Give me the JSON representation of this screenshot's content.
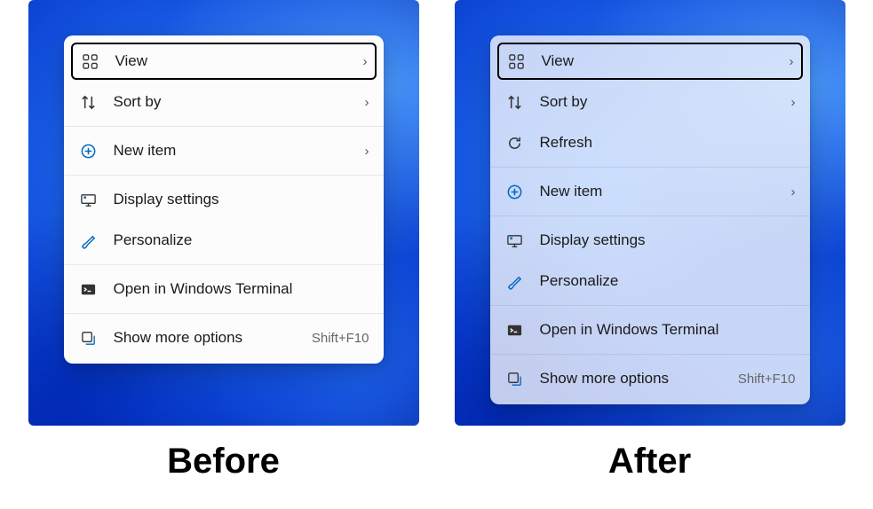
{
  "before": {
    "caption": "Before",
    "menu": [
      {
        "name": "view",
        "label": "View",
        "icon": "view",
        "chevron": true,
        "highlighted": true
      },
      {
        "name": "sort-by",
        "label": "Sort by",
        "icon": "sort",
        "chevron": true
      },
      {
        "sep": true
      },
      {
        "name": "new-item",
        "label": "New item",
        "icon": "new",
        "chevron": true
      },
      {
        "sep": true
      },
      {
        "name": "display-settings",
        "label": "Display settings",
        "icon": "display"
      },
      {
        "name": "personalize",
        "label": "Personalize",
        "icon": "brush"
      },
      {
        "sep": true
      },
      {
        "name": "open-terminal",
        "label": "Open in Windows Terminal",
        "icon": "terminal"
      },
      {
        "sep": true
      },
      {
        "name": "show-more",
        "label": "Show more options",
        "icon": "more",
        "shortcut": "Shift+F10"
      }
    ]
  },
  "after": {
    "caption": "After",
    "menu": [
      {
        "name": "view",
        "label": "View",
        "icon": "view",
        "chevron": true,
        "highlighted": true
      },
      {
        "name": "sort-by",
        "label": "Sort by",
        "icon": "sort",
        "chevron": true
      },
      {
        "name": "refresh",
        "label": "Refresh",
        "icon": "refresh"
      },
      {
        "sep": true
      },
      {
        "name": "new-item",
        "label": "New item",
        "icon": "new",
        "chevron": true
      },
      {
        "sep": true
      },
      {
        "name": "display-settings",
        "label": "Display settings",
        "icon": "display"
      },
      {
        "name": "personalize",
        "label": "Personalize",
        "icon": "brush"
      },
      {
        "sep": true
      },
      {
        "name": "open-terminal",
        "label": "Open in Windows Terminal",
        "icon": "terminal"
      },
      {
        "sep": true
      },
      {
        "name": "show-more",
        "label": "Show more options",
        "icon": "more",
        "shortcut": "Shift+F10"
      }
    ]
  },
  "icons": {
    "view": "<svg viewBox='0 0 20 20' fill='none' stroke='currentColor' stroke-width='1.4'><rect x='2' y='2' width='6' height='6' rx='1.5'/><rect x='12' y='2' width='6' height='6' rx='1.5'/><rect x='2' y='12' width='6' height='6' rx='1.5'/><rect x='12' y='12' width='6' height='6' rx='1.5'/></svg>",
    "sort": "<svg viewBox='0 0 20 20' fill='none' stroke='currentColor' stroke-width='1.6'><path d='M6 3v14M3 6l3-3 3 3M14 17V3M11 14l3 3 3-3'/></svg>",
    "refresh": "<svg viewBox='0 0 20 20' fill='none' stroke='currentColor' stroke-width='1.6'><path d='M16 10a6 6 0 1 1-1.8-4.3M16 3v4h-4'/></svg>",
    "new": "<svg viewBox='0 0 20 20' fill='none' stroke='#0067c0' stroke-width='1.6'><circle cx='10' cy='10' r='7.5'/><path d='M10 6v8M6 10h8'/></svg>",
    "display": "<svg viewBox='0 0 20 20' fill='none' stroke='currentColor' stroke-width='1.4'><rect x='2' y='4' width='16' height='10' rx='1'/><path d='M7 17h6M10 14v3'/><circle cx='6' cy='7' r='1.5' fill='#0067c0' stroke='none'/></svg>",
    "brush": "<svg viewBox='0 0 20 20' fill='none' stroke='#0067c0' stroke-width='1.5'><path d='M3 17c1-3 3-3 4-4l8-8 2 2-8 8c-1 1-1 3-4 4z'/></svg>",
    "terminal": "<svg viewBox='0 0 20 20'><rect x='2' y='4' width='16' height='12' rx='1.5' fill='#333'/><path d='M5 8l2.5 2L5 12M9 12h4' stroke='#fff' stroke-width='1.4' fill='none'/></svg>",
    "more": "<svg viewBox='0 0 20 20' fill='none' stroke='currentColor' stroke-width='1.4'><rect x='3' y='3' width='11' height='11' rx='1.5'/><path d='M7 17h9a1 1 0 0 0 1-1V7' stroke='#0067c0'/></svg>"
  }
}
